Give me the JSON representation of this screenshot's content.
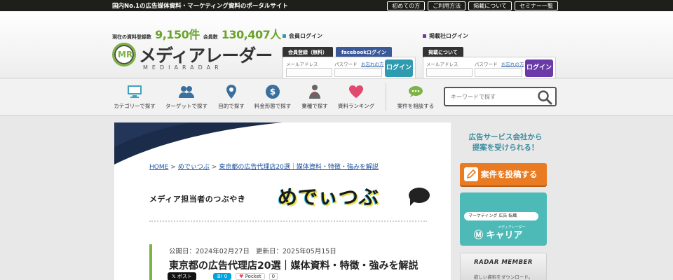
{
  "topbar": {
    "tagline": "国内No.1の広告媒体資料・マーケティング資料のポータルサイト",
    "links": [
      "初めての方",
      "ご利用方法",
      "掲載について",
      "セミナー一覧"
    ]
  },
  "stats": {
    "docs_label": "現在の資料登録数",
    "docs_value": "9,150件",
    "members_label": "会員数",
    "members_value": "130,407人"
  },
  "logo": {
    "mark": "MR",
    "name": "メディアレーダー",
    "sub": "MEDIARADAR"
  },
  "member_login": {
    "title": "会員ログイン",
    "tab_register": "会員登録（無料）",
    "tab_facebook": "facebookログイン",
    "email_label": "メールアドレス",
    "password_label": "パスワード",
    "forgot": "お忘れの方",
    "login_button": "ログイン",
    "accent": "#2f9bb0"
  },
  "publisher_login": {
    "title": "掲載社ログイン",
    "tab_about": "掲載について",
    "email_label": "メールアドレス",
    "password_label": "パスワード",
    "forgot": "お忘れの方",
    "login_button": "ログイン",
    "accent": "#6a3aa8"
  },
  "nav": {
    "items": [
      {
        "label": "カテゴリーで探す",
        "icon": "monitor-icon"
      },
      {
        "label": "ターゲットで探す",
        "icon": "users-icon"
      },
      {
        "label": "目的で探す",
        "icon": "map-pin-icon"
      },
      {
        "label": "料金形態で探す",
        "icon": "dollar-icon"
      },
      {
        "label": "業種で探す",
        "icon": "businessman-icon"
      },
      {
        "label": "資料ランキング",
        "icon": "heart-icon"
      },
      {
        "label": "案件を相談する",
        "icon": "chat-icon"
      }
    ],
    "search_placeholder": "キーワードで探す"
  },
  "breadcrumb": {
    "home": "HOME",
    "section": "めでぃつぶ",
    "current": "東京都の広告代理店20選｜媒体資料・特徴・強みを解説",
    "separator": ">"
  },
  "brand": {
    "tagline": "メディア担当者のつぶやき",
    "logo": "めでぃつぶ"
  },
  "article": {
    "published_label": "公開日：",
    "published": "2024年02月27日",
    "updated_label": "更新日：",
    "updated": "2025年05月15日",
    "title": "東京都の広告代理店20選｜媒体資料・特徴・強みを解説"
  },
  "share": {
    "x_label": "ポスト",
    "hatena_label": "B! 0",
    "pocket_label": "Pocket",
    "pocket_count": "0"
  },
  "sidebar": {
    "promo_line1": "広告サービス会社から",
    "promo_line2": "提案を受けられる！",
    "post_button": "案件を投稿する",
    "career_search": "マーケティング 広告 転職",
    "career_small": "メディアレーダー",
    "career_logo": "キャリア",
    "member_title": "RADAR MEMBER",
    "member_desc": "欲しい資料をダウンロード。"
  }
}
